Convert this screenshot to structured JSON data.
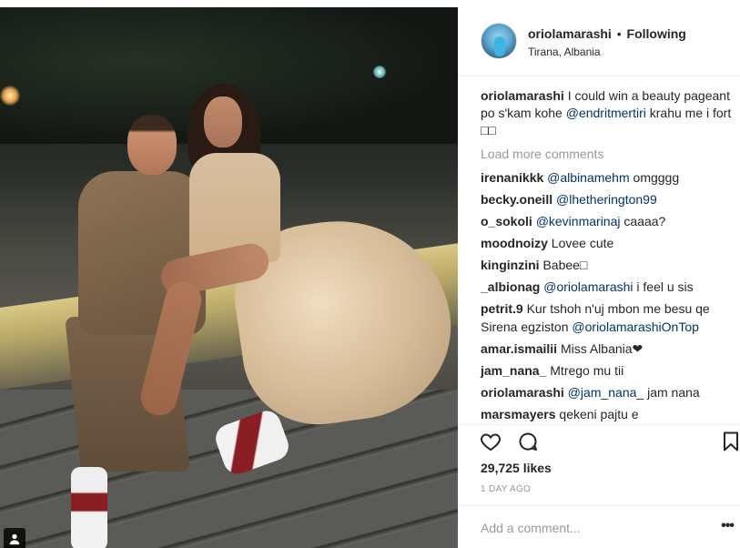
{
  "post": {
    "author": {
      "username": "oriolamarashi",
      "separator": "•",
      "follow_status": "Following",
      "location": "Tirana, Albania"
    },
    "caption": {
      "username": "oriolamarashi",
      "text": "I could win a beauty pageant po s'kam kohe",
      "mention": "@endritmertiri",
      "text2": "krahu me i fort □□"
    },
    "load_more": "Load more comments",
    "comments": [
      {
        "username": "irenanikkk",
        "mention": "@albinamehm",
        "text": "omgggg"
      },
      {
        "username": "becky.oneill",
        "mention": "@lhetherington99",
        "text": ""
      },
      {
        "username": "o_sokoli",
        "mention": "@kevinmarinaj",
        "text": "caaaa?"
      },
      {
        "username": "moodnoizy",
        "mention": "",
        "text": "Lovee cute"
      },
      {
        "username": "kinginzini",
        "mention": "",
        "text": "Babee□"
      },
      {
        "username": "_albionag",
        "mention": "@oriolamarashi",
        "text": "i feel u sis"
      },
      {
        "username": "petrit.9",
        "mention": "",
        "text": "Kur tshoh n'uj mbon me besu qe Sirena egziston",
        "mention2": "@oriolamarashiOnTop"
      },
      {
        "username": "amar.ismailii",
        "mention": "",
        "text": "Miss Albania❤"
      },
      {
        "username": "jam_nana_",
        "mention": "",
        "text": "Mtrego mu tii"
      },
      {
        "username": "oriolamarashi",
        "mention": "@jam_nana_",
        "text": "jam nana"
      },
      {
        "username": "marsmayers",
        "mention": "",
        "text": "qekeni pajtu e"
      }
    ],
    "likes": "29,725 likes",
    "time": "1 DAY AGO",
    "add_comment_placeholder": "Add a comment...",
    "more_label": "•••"
  },
  "icons": {
    "like": "heart-icon",
    "comment": "comment-bubble-icon",
    "save": "bookmark-icon",
    "tagged": "user-tag-icon",
    "more": "ellipsis-icon"
  },
  "colors": {
    "text": "#262626",
    "muted": "#999999",
    "mention": "#003569",
    "border": "#efefef"
  }
}
